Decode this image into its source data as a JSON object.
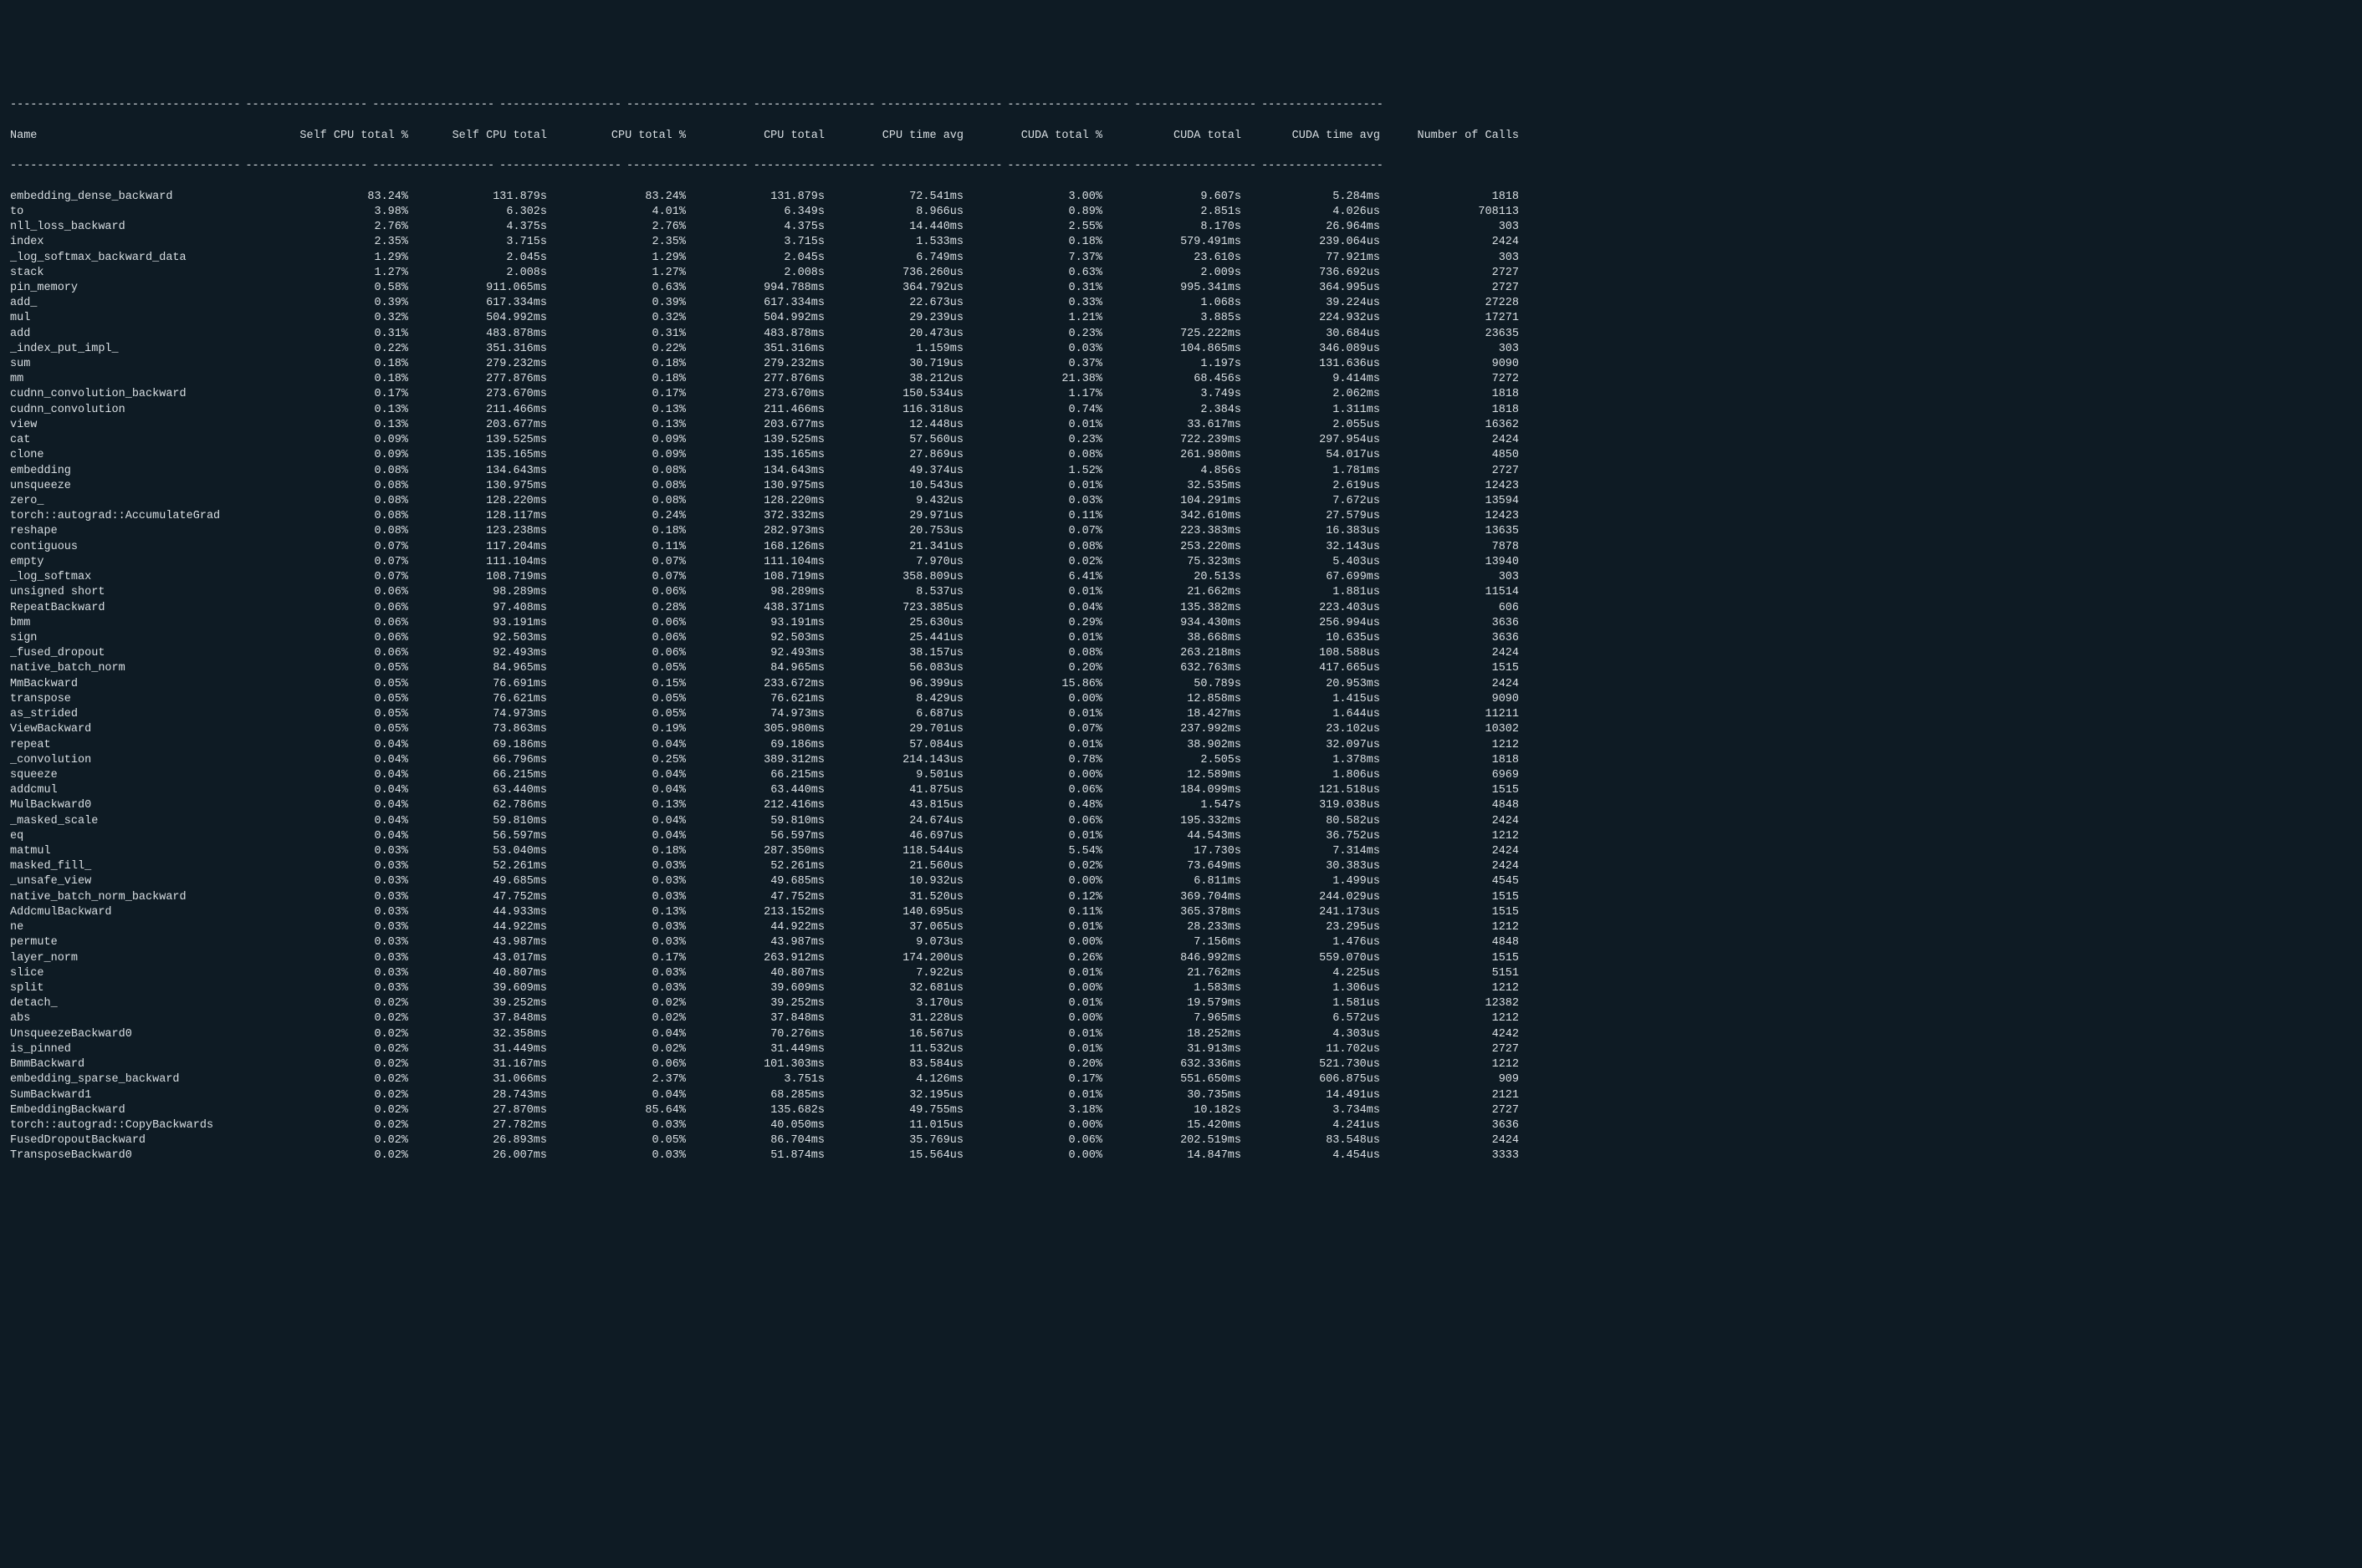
{
  "headers": [
    "Name",
    "Self CPU total %",
    "Self CPU total",
    "CPU total %",
    "CPU total",
    "CPU time avg",
    "CUDA total %",
    "CUDA total",
    "CUDA time avg",
    "Number of Calls"
  ],
  "rows": [
    {
      "name": "embedding_dense_backward",
      "self_cpu_pct": "83.24%",
      "self_cpu": "131.879s",
      "cpu_pct": "83.24%",
      "cpu_total": "131.879s",
      "cpu_avg": "72.541ms",
      "cuda_pct": "3.00%",
      "cuda_total": "9.607s",
      "cuda_avg": "5.284ms",
      "calls": "1818"
    },
    {
      "name": "to",
      "self_cpu_pct": "3.98%",
      "self_cpu": "6.302s",
      "cpu_pct": "4.01%",
      "cpu_total": "6.349s",
      "cpu_avg": "8.966us",
      "cuda_pct": "0.89%",
      "cuda_total": "2.851s",
      "cuda_avg": "4.026us",
      "calls": "708113"
    },
    {
      "name": "nll_loss_backward",
      "self_cpu_pct": "2.76%",
      "self_cpu": "4.375s",
      "cpu_pct": "2.76%",
      "cpu_total": "4.375s",
      "cpu_avg": "14.440ms",
      "cuda_pct": "2.55%",
      "cuda_total": "8.170s",
      "cuda_avg": "26.964ms",
      "calls": "303"
    },
    {
      "name": "index",
      "self_cpu_pct": "2.35%",
      "self_cpu": "3.715s",
      "cpu_pct": "2.35%",
      "cpu_total": "3.715s",
      "cpu_avg": "1.533ms",
      "cuda_pct": "0.18%",
      "cuda_total": "579.491ms",
      "cuda_avg": "239.064us",
      "calls": "2424"
    },
    {
      "name": "_log_softmax_backward_data",
      "self_cpu_pct": "1.29%",
      "self_cpu": "2.045s",
      "cpu_pct": "1.29%",
      "cpu_total": "2.045s",
      "cpu_avg": "6.749ms",
      "cuda_pct": "7.37%",
      "cuda_total": "23.610s",
      "cuda_avg": "77.921ms",
      "calls": "303"
    },
    {
      "name": "stack",
      "self_cpu_pct": "1.27%",
      "self_cpu": "2.008s",
      "cpu_pct": "1.27%",
      "cpu_total": "2.008s",
      "cpu_avg": "736.260us",
      "cuda_pct": "0.63%",
      "cuda_total": "2.009s",
      "cuda_avg": "736.692us",
      "calls": "2727"
    },
    {
      "name": "pin_memory",
      "self_cpu_pct": "0.58%",
      "self_cpu": "911.065ms",
      "cpu_pct": "0.63%",
      "cpu_total": "994.788ms",
      "cpu_avg": "364.792us",
      "cuda_pct": "0.31%",
      "cuda_total": "995.341ms",
      "cuda_avg": "364.995us",
      "calls": "2727"
    },
    {
      "name": "add_",
      "self_cpu_pct": "0.39%",
      "self_cpu": "617.334ms",
      "cpu_pct": "0.39%",
      "cpu_total": "617.334ms",
      "cpu_avg": "22.673us",
      "cuda_pct": "0.33%",
      "cuda_total": "1.068s",
      "cuda_avg": "39.224us",
      "calls": "27228"
    },
    {
      "name": "mul",
      "self_cpu_pct": "0.32%",
      "self_cpu": "504.992ms",
      "cpu_pct": "0.32%",
      "cpu_total": "504.992ms",
      "cpu_avg": "29.239us",
      "cuda_pct": "1.21%",
      "cuda_total": "3.885s",
      "cuda_avg": "224.932us",
      "calls": "17271"
    },
    {
      "name": "add",
      "self_cpu_pct": "0.31%",
      "self_cpu": "483.878ms",
      "cpu_pct": "0.31%",
      "cpu_total": "483.878ms",
      "cpu_avg": "20.473us",
      "cuda_pct": "0.23%",
      "cuda_total": "725.222ms",
      "cuda_avg": "30.684us",
      "calls": "23635"
    },
    {
      "name": "_index_put_impl_",
      "self_cpu_pct": "0.22%",
      "self_cpu": "351.316ms",
      "cpu_pct": "0.22%",
      "cpu_total": "351.316ms",
      "cpu_avg": "1.159ms",
      "cuda_pct": "0.03%",
      "cuda_total": "104.865ms",
      "cuda_avg": "346.089us",
      "calls": "303"
    },
    {
      "name": "sum",
      "self_cpu_pct": "0.18%",
      "self_cpu": "279.232ms",
      "cpu_pct": "0.18%",
      "cpu_total": "279.232ms",
      "cpu_avg": "30.719us",
      "cuda_pct": "0.37%",
      "cuda_total": "1.197s",
      "cuda_avg": "131.636us",
      "calls": "9090"
    },
    {
      "name": "mm",
      "self_cpu_pct": "0.18%",
      "self_cpu": "277.876ms",
      "cpu_pct": "0.18%",
      "cpu_total": "277.876ms",
      "cpu_avg": "38.212us",
      "cuda_pct": "21.38%",
      "cuda_total": "68.456s",
      "cuda_avg": "9.414ms",
      "calls": "7272"
    },
    {
      "name": "cudnn_convolution_backward",
      "self_cpu_pct": "0.17%",
      "self_cpu": "273.670ms",
      "cpu_pct": "0.17%",
      "cpu_total": "273.670ms",
      "cpu_avg": "150.534us",
      "cuda_pct": "1.17%",
      "cuda_total": "3.749s",
      "cuda_avg": "2.062ms",
      "calls": "1818"
    },
    {
      "name": "cudnn_convolution",
      "self_cpu_pct": "0.13%",
      "self_cpu": "211.466ms",
      "cpu_pct": "0.13%",
      "cpu_total": "211.466ms",
      "cpu_avg": "116.318us",
      "cuda_pct": "0.74%",
      "cuda_total": "2.384s",
      "cuda_avg": "1.311ms",
      "calls": "1818"
    },
    {
      "name": "view",
      "self_cpu_pct": "0.13%",
      "self_cpu": "203.677ms",
      "cpu_pct": "0.13%",
      "cpu_total": "203.677ms",
      "cpu_avg": "12.448us",
      "cuda_pct": "0.01%",
      "cuda_total": "33.617ms",
      "cuda_avg": "2.055us",
      "calls": "16362"
    },
    {
      "name": "cat",
      "self_cpu_pct": "0.09%",
      "self_cpu": "139.525ms",
      "cpu_pct": "0.09%",
      "cpu_total": "139.525ms",
      "cpu_avg": "57.560us",
      "cuda_pct": "0.23%",
      "cuda_total": "722.239ms",
      "cuda_avg": "297.954us",
      "calls": "2424"
    },
    {
      "name": "clone",
      "self_cpu_pct": "0.09%",
      "self_cpu": "135.165ms",
      "cpu_pct": "0.09%",
      "cpu_total": "135.165ms",
      "cpu_avg": "27.869us",
      "cuda_pct": "0.08%",
      "cuda_total": "261.980ms",
      "cuda_avg": "54.017us",
      "calls": "4850"
    },
    {
      "name": "embedding",
      "self_cpu_pct": "0.08%",
      "self_cpu": "134.643ms",
      "cpu_pct": "0.08%",
      "cpu_total": "134.643ms",
      "cpu_avg": "49.374us",
      "cuda_pct": "1.52%",
      "cuda_total": "4.856s",
      "cuda_avg": "1.781ms",
      "calls": "2727"
    },
    {
      "name": "unsqueeze",
      "self_cpu_pct": "0.08%",
      "self_cpu": "130.975ms",
      "cpu_pct": "0.08%",
      "cpu_total": "130.975ms",
      "cpu_avg": "10.543us",
      "cuda_pct": "0.01%",
      "cuda_total": "32.535ms",
      "cuda_avg": "2.619us",
      "calls": "12423"
    },
    {
      "name": "zero_",
      "self_cpu_pct": "0.08%",
      "self_cpu": "128.220ms",
      "cpu_pct": "0.08%",
      "cpu_total": "128.220ms",
      "cpu_avg": "9.432us",
      "cuda_pct": "0.03%",
      "cuda_total": "104.291ms",
      "cuda_avg": "7.672us",
      "calls": "13594"
    },
    {
      "name": "torch::autograd::AccumulateGrad",
      "self_cpu_pct": "0.08%",
      "self_cpu": "128.117ms",
      "cpu_pct": "0.24%",
      "cpu_total": "372.332ms",
      "cpu_avg": "29.971us",
      "cuda_pct": "0.11%",
      "cuda_total": "342.610ms",
      "cuda_avg": "27.579us",
      "calls": "12423"
    },
    {
      "name": "reshape",
      "self_cpu_pct": "0.08%",
      "self_cpu": "123.238ms",
      "cpu_pct": "0.18%",
      "cpu_total": "282.973ms",
      "cpu_avg": "20.753us",
      "cuda_pct": "0.07%",
      "cuda_total": "223.383ms",
      "cuda_avg": "16.383us",
      "calls": "13635"
    },
    {
      "name": "contiguous",
      "self_cpu_pct": "0.07%",
      "self_cpu": "117.204ms",
      "cpu_pct": "0.11%",
      "cpu_total": "168.126ms",
      "cpu_avg": "21.341us",
      "cuda_pct": "0.08%",
      "cuda_total": "253.220ms",
      "cuda_avg": "32.143us",
      "calls": "7878"
    },
    {
      "name": "empty",
      "self_cpu_pct": "0.07%",
      "self_cpu": "111.104ms",
      "cpu_pct": "0.07%",
      "cpu_total": "111.104ms",
      "cpu_avg": "7.970us",
      "cuda_pct": "0.02%",
      "cuda_total": "75.323ms",
      "cuda_avg": "5.403us",
      "calls": "13940"
    },
    {
      "name": "_log_softmax",
      "self_cpu_pct": "0.07%",
      "self_cpu": "108.719ms",
      "cpu_pct": "0.07%",
      "cpu_total": "108.719ms",
      "cpu_avg": "358.809us",
      "cuda_pct": "6.41%",
      "cuda_total": "20.513s",
      "cuda_avg": "67.699ms",
      "calls": "303"
    },
    {
      "name": "unsigned short",
      "self_cpu_pct": "0.06%",
      "self_cpu": "98.289ms",
      "cpu_pct": "0.06%",
      "cpu_total": "98.289ms",
      "cpu_avg": "8.537us",
      "cuda_pct": "0.01%",
      "cuda_total": "21.662ms",
      "cuda_avg": "1.881us",
      "calls": "11514"
    },
    {
      "name": "RepeatBackward",
      "self_cpu_pct": "0.06%",
      "self_cpu": "97.408ms",
      "cpu_pct": "0.28%",
      "cpu_total": "438.371ms",
      "cpu_avg": "723.385us",
      "cuda_pct": "0.04%",
      "cuda_total": "135.382ms",
      "cuda_avg": "223.403us",
      "calls": "606"
    },
    {
      "name": "bmm",
      "self_cpu_pct": "0.06%",
      "self_cpu": "93.191ms",
      "cpu_pct": "0.06%",
      "cpu_total": "93.191ms",
      "cpu_avg": "25.630us",
      "cuda_pct": "0.29%",
      "cuda_total": "934.430ms",
      "cuda_avg": "256.994us",
      "calls": "3636"
    },
    {
      "name": "sign",
      "self_cpu_pct": "0.06%",
      "self_cpu": "92.503ms",
      "cpu_pct": "0.06%",
      "cpu_total": "92.503ms",
      "cpu_avg": "25.441us",
      "cuda_pct": "0.01%",
      "cuda_total": "38.668ms",
      "cuda_avg": "10.635us",
      "calls": "3636"
    },
    {
      "name": "_fused_dropout",
      "self_cpu_pct": "0.06%",
      "self_cpu": "92.493ms",
      "cpu_pct": "0.06%",
      "cpu_total": "92.493ms",
      "cpu_avg": "38.157us",
      "cuda_pct": "0.08%",
      "cuda_total": "263.218ms",
      "cuda_avg": "108.588us",
      "calls": "2424"
    },
    {
      "name": "native_batch_norm",
      "self_cpu_pct": "0.05%",
      "self_cpu": "84.965ms",
      "cpu_pct": "0.05%",
      "cpu_total": "84.965ms",
      "cpu_avg": "56.083us",
      "cuda_pct": "0.20%",
      "cuda_total": "632.763ms",
      "cuda_avg": "417.665us",
      "calls": "1515"
    },
    {
      "name": "MmBackward",
      "self_cpu_pct": "0.05%",
      "self_cpu": "76.691ms",
      "cpu_pct": "0.15%",
      "cpu_total": "233.672ms",
      "cpu_avg": "96.399us",
      "cuda_pct": "15.86%",
      "cuda_total": "50.789s",
      "cuda_avg": "20.953ms",
      "calls": "2424"
    },
    {
      "name": "transpose",
      "self_cpu_pct": "0.05%",
      "self_cpu": "76.621ms",
      "cpu_pct": "0.05%",
      "cpu_total": "76.621ms",
      "cpu_avg": "8.429us",
      "cuda_pct": "0.00%",
      "cuda_total": "12.858ms",
      "cuda_avg": "1.415us",
      "calls": "9090"
    },
    {
      "name": "as_strided",
      "self_cpu_pct": "0.05%",
      "self_cpu": "74.973ms",
      "cpu_pct": "0.05%",
      "cpu_total": "74.973ms",
      "cpu_avg": "6.687us",
      "cuda_pct": "0.01%",
      "cuda_total": "18.427ms",
      "cuda_avg": "1.644us",
      "calls": "11211"
    },
    {
      "name": "ViewBackward",
      "self_cpu_pct": "0.05%",
      "self_cpu": "73.863ms",
      "cpu_pct": "0.19%",
      "cpu_total": "305.980ms",
      "cpu_avg": "29.701us",
      "cuda_pct": "0.07%",
      "cuda_total": "237.992ms",
      "cuda_avg": "23.102us",
      "calls": "10302"
    },
    {
      "name": "repeat",
      "self_cpu_pct": "0.04%",
      "self_cpu": "69.186ms",
      "cpu_pct": "0.04%",
      "cpu_total": "69.186ms",
      "cpu_avg": "57.084us",
      "cuda_pct": "0.01%",
      "cuda_total": "38.902ms",
      "cuda_avg": "32.097us",
      "calls": "1212"
    },
    {
      "name": "_convolution",
      "self_cpu_pct": "0.04%",
      "self_cpu": "66.796ms",
      "cpu_pct": "0.25%",
      "cpu_total": "389.312ms",
      "cpu_avg": "214.143us",
      "cuda_pct": "0.78%",
      "cuda_total": "2.505s",
      "cuda_avg": "1.378ms",
      "calls": "1818"
    },
    {
      "name": "squeeze",
      "self_cpu_pct": "0.04%",
      "self_cpu": "66.215ms",
      "cpu_pct": "0.04%",
      "cpu_total": "66.215ms",
      "cpu_avg": "9.501us",
      "cuda_pct": "0.00%",
      "cuda_total": "12.589ms",
      "cuda_avg": "1.806us",
      "calls": "6969"
    },
    {
      "name": "addcmul",
      "self_cpu_pct": "0.04%",
      "self_cpu": "63.440ms",
      "cpu_pct": "0.04%",
      "cpu_total": "63.440ms",
      "cpu_avg": "41.875us",
      "cuda_pct": "0.06%",
      "cuda_total": "184.099ms",
      "cuda_avg": "121.518us",
      "calls": "1515"
    },
    {
      "name": "MulBackward0",
      "self_cpu_pct": "0.04%",
      "self_cpu": "62.786ms",
      "cpu_pct": "0.13%",
      "cpu_total": "212.416ms",
      "cpu_avg": "43.815us",
      "cuda_pct": "0.48%",
      "cuda_total": "1.547s",
      "cuda_avg": "319.038us",
      "calls": "4848"
    },
    {
      "name": "_masked_scale",
      "self_cpu_pct": "0.04%",
      "self_cpu": "59.810ms",
      "cpu_pct": "0.04%",
      "cpu_total": "59.810ms",
      "cpu_avg": "24.674us",
      "cuda_pct": "0.06%",
      "cuda_total": "195.332ms",
      "cuda_avg": "80.582us",
      "calls": "2424"
    },
    {
      "name": "eq",
      "self_cpu_pct": "0.04%",
      "self_cpu": "56.597ms",
      "cpu_pct": "0.04%",
      "cpu_total": "56.597ms",
      "cpu_avg": "46.697us",
      "cuda_pct": "0.01%",
      "cuda_total": "44.543ms",
      "cuda_avg": "36.752us",
      "calls": "1212"
    },
    {
      "name": "matmul",
      "self_cpu_pct": "0.03%",
      "self_cpu": "53.040ms",
      "cpu_pct": "0.18%",
      "cpu_total": "287.350ms",
      "cpu_avg": "118.544us",
      "cuda_pct": "5.54%",
      "cuda_total": "17.730s",
      "cuda_avg": "7.314ms",
      "calls": "2424"
    },
    {
      "name": "masked_fill_",
      "self_cpu_pct": "0.03%",
      "self_cpu": "52.261ms",
      "cpu_pct": "0.03%",
      "cpu_total": "52.261ms",
      "cpu_avg": "21.560us",
      "cuda_pct": "0.02%",
      "cuda_total": "73.649ms",
      "cuda_avg": "30.383us",
      "calls": "2424"
    },
    {
      "name": "_unsafe_view",
      "self_cpu_pct": "0.03%",
      "self_cpu": "49.685ms",
      "cpu_pct": "0.03%",
      "cpu_total": "49.685ms",
      "cpu_avg": "10.932us",
      "cuda_pct": "0.00%",
      "cuda_total": "6.811ms",
      "cuda_avg": "1.499us",
      "calls": "4545"
    },
    {
      "name": "native_batch_norm_backward",
      "self_cpu_pct": "0.03%",
      "self_cpu": "47.752ms",
      "cpu_pct": "0.03%",
      "cpu_total": "47.752ms",
      "cpu_avg": "31.520us",
      "cuda_pct": "0.12%",
      "cuda_total": "369.704ms",
      "cuda_avg": "244.029us",
      "calls": "1515"
    },
    {
      "name": "AddcmulBackward",
      "self_cpu_pct": "0.03%",
      "self_cpu": "44.933ms",
      "cpu_pct": "0.13%",
      "cpu_total": "213.152ms",
      "cpu_avg": "140.695us",
      "cuda_pct": "0.11%",
      "cuda_total": "365.378ms",
      "cuda_avg": "241.173us",
      "calls": "1515"
    },
    {
      "name": "ne",
      "self_cpu_pct": "0.03%",
      "self_cpu": "44.922ms",
      "cpu_pct": "0.03%",
      "cpu_total": "44.922ms",
      "cpu_avg": "37.065us",
      "cuda_pct": "0.01%",
      "cuda_total": "28.233ms",
      "cuda_avg": "23.295us",
      "calls": "1212"
    },
    {
      "name": "permute",
      "self_cpu_pct": "0.03%",
      "self_cpu": "43.987ms",
      "cpu_pct": "0.03%",
      "cpu_total": "43.987ms",
      "cpu_avg": "9.073us",
      "cuda_pct": "0.00%",
      "cuda_total": "7.156ms",
      "cuda_avg": "1.476us",
      "calls": "4848"
    },
    {
      "name": "layer_norm",
      "self_cpu_pct": "0.03%",
      "self_cpu": "43.017ms",
      "cpu_pct": "0.17%",
      "cpu_total": "263.912ms",
      "cpu_avg": "174.200us",
      "cuda_pct": "0.26%",
      "cuda_total": "846.992ms",
      "cuda_avg": "559.070us",
      "calls": "1515"
    },
    {
      "name": "slice",
      "self_cpu_pct": "0.03%",
      "self_cpu": "40.807ms",
      "cpu_pct": "0.03%",
      "cpu_total": "40.807ms",
      "cpu_avg": "7.922us",
      "cuda_pct": "0.01%",
      "cuda_total": "21.762ms",
      "cuda_avg": "4.225us",
      "calls": "5151"
    },
    {
      "name": "split",
      "self_cpu_pct": "0.03%",
      "self_cpu": "39.609ms",
      "cpu_pct": "0.03%",
      "cpu_total": "39.609ms",
      "cpu_avg": "32.681us",
      "cuda_pct": "0.00%",
      "cuda_total": "1.583ms",
      "cuda_avg": "1.306us",
      "calls": "1212"
    },
    {
      "name": "detach_",
      "self_cpu_pct": "0.02%",
      "self_cpu": "39.252ms",
      "cpu_pct": "0.02%",
      "cpu_total": "39.252ms",
      "cpu_avg": "3.170us",
      "cuda_pct": "0.01%",
      "cuda_total": "19.579ms",
      "cuda_avg": "1.581us",
      "calls": "12382"
    },
    {
      "name": "abs",
      "self_cpu_pct": "0.02%",
      "self_cpu": "37.848ms",
      "cpu_pct": "0.02%",
      "cpu_total": "37.848ms",
      "cpu_avg": "31.228us",
      "cuda_pct": "0.00%",
      "cuda_total": "7.965ms",
      "cuda_avg": "6.572us",
      "calls": "1212"
    },
    {
      "name": "UnsqueezeBackward0",
      "self_cpu_pct": "0.02%",
      "self_cpu": "32.358ms",
      "cpu_pct": "0.04%",
      "cpu_total": "70.276ms",
      "cpu_avg": "16.567us",
      "cuda_pct": "0.01%",
      "cuda_total": "18.252ms",
      "cuda_avg": "4.303us",
      "calls": "4242"
    },
    {
      "name": "is_pinned",
      "self_cpu_pct": "0.02%",
      "self_cpu": "31.449ms",
      "cpu_pct": "0.02%",
      "cpu_total": "31.449ms",
      "cpu_avg": "11.532us",
      "cuda_pct": "0.01%",
      "cuda_total": "31.913ms",
      "cuda_avg": "11.702us",
      "calls": "2727"
    },
    {
      "name": "BmmBackward",
      "self_cpu_pct": "0.02%",
      "self_cpu": "31.167ms",
      "cpu_pct": "0.06%",
      "cpu_total": "101.303ms",
      "cpu_avg": "83.584us",
      "cuda_pct": "0.20%",
      "cuda_total": "632.336ms",
      "cuda_avg": "521.730us",
      "calls": "1212"
    },
    {
      "name": "embedding_sparse_backward",
      "self_cpu_pct": "0.02%",
      "self_cpu": "31.066ms",
      "cpu_pct": "2.37%",
      "cpu_total": "3.751s",
      "cpu_avg": "4.126ms",
      "cuda_pct": "0.17%",
      "cuda_total": "551.650ms",
      "cuda_avg": "606.875us",
      "calls": "909"
    },
    {
      "name": "SumBackward1",
      "self_cpu_pct": "0.02%",
      "self_cpu": "28.743ms",
      "cpu_pct": "0.04%",
      "cpu_total": "68.285ms",
      "cpu_avg": "32.195us",
      "cuda_pct": "0.01%",
      "cuda_total": "30.735ms",
      "cuda_avg": "14.491us",
      "calls": "2121"
    },
    {
      "name": "EmbeddingBackward",
      "self_cpu_pct": "0.02%",
      "self_cpu": "27.870ms",
      "cpu_pct": "85.64%",
      "cpu_total": "135.682s",
      "cpu_avg": "49.755ms",
      "cuda_pct": "3.18%",
      "cuda_total": "10.182s",
      "cuda_avg": "3.734ms",
      "calls": "2727"
    },
    {
      "name": "torch::autograd::CopyBackwards",
      "self_cpu_pct": "0.02%",
      "self_cpu": "27.782ms",
      "cpu_pct": "0.03%",
      "cpu_total": "40.050ms",
      "cpu_avg": "11.015us",
      "cuda_pct": "0.00%",
      "cuda_total": "15.420ms",
      "cuda_avg": "4.241us",
      "calls": "3636"
    },
    {
      "name": "FusedDropoutBackward",
      "self_cpu_pct": "0.02%",
      "self_cpu": "26.893ms",
      "cpu_pct": "0.05%",
      "cpu_total": "86.704ms",
      "cpu_avg": "35.769us",
      "cuda_pct": "0.06%",
      "cuda_total": "202.519ms",
      "cuda_avg": "83.548us",
      "calls": "2424"
    },
    {
      "name": "TransposeBackward0",
      "self_cpu_pct": "0.02%",
      "self_cpu": "26.007ms",
      "cpu_pct": "0.03%",
      "cpu_total": "51.874ms",
      "cpu_avg": "15.564us",
      "cuda_pct": "0.00%",
      "cuda_total": "14.847ms",
      "cuda_avg": "4.454us",
      "calls": "3333"
    }
  ]
}
